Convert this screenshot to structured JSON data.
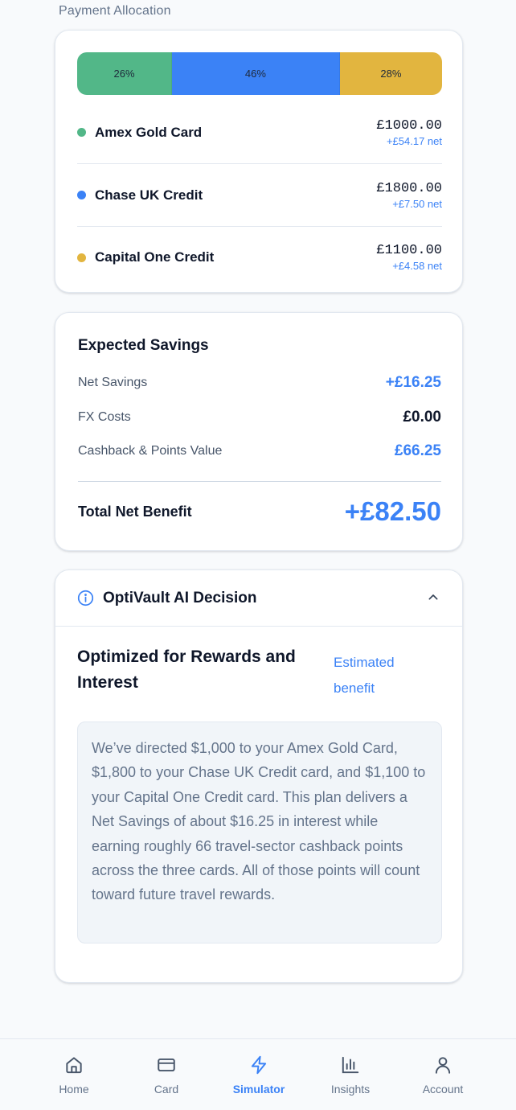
{
  "section_label": "Payment Allocation",
  "allocation": {
    "segments": [
      {
        "label": "26%",
        "fraction": 0.26,
        "color": "#52b788"
      },
      {
        "label": "46%",
        "fraction": 0.46,
        "color": "#3b82f6"
      },
      {
        "label": "28%",
        "fraction": 0.28,
        "color": "#e2b53f"
      }
    ],
    "cards": [
      {
        "name": "Amex Gold Card",
        "amount": "£1000.00",
        "net": "+£54.17 net",
        "color": "#52b788"
      },
      {
        "name": "Chase UK Credit",
        "amount": "£1800.00",
        "net": "+£7.50 net",
        "color": "#3b82f6"
      },
      {
        "name": "Capital One Credit",
        "amount": "£1100.00",
        "net": "+£4.58 net",
        "color": "#e2b53f"
      }
    ]
  },
  "savings": {
    "title": "Expected Savings",
    "net_label": "Net Savings",
    "net_value": "+£16.25",
    "fx_label": "FX Costs",
    "fx_value": "£0.00",
    "cashback_label": "Cashback & Points Value",
    "cashback_value": "£66.25",
    "total_label": "Total Net Benefit",
    "total_value": "+£82.50"
  },
  "ai_decision": {
    "title": "OptiVault AI Decision",
    "subtitle": "Optimized for Rewards and Interest",
    "estimated": "Estimated benefit",
    "body": "We’ve directed $1,000 to your Amex Gold Card, $1,800 to your Chase UK Credit card, and $1,100 to your Capital One Credit card. This plan delivers a Net Savings of about $16.25 in interest while earning roughly 66 travel-sector cashback points across the three cards. All of those points will count toward future travel rewards."
  },
  "nav": {
    "items": [
      {
        "label": "Home",
        "icon": "home-icon"
      },
      {
        "label": "Card",
        "icon": "credit-card-icon"
      },
      {
        "label": "Simulator",
        "icon": "lightning-icon",
        "active": true
      },
      {
        "label": "Insights",
        "icon": "bar-chart-icon"
      },
      {
        "label": "Account",
        "icon": "user-icon"
      }
    ]
  },
  "colors": {
    "accent": "#3b82f6",
    "green": "#52b788",
    "gold": "#e2b53f"
  }
}
